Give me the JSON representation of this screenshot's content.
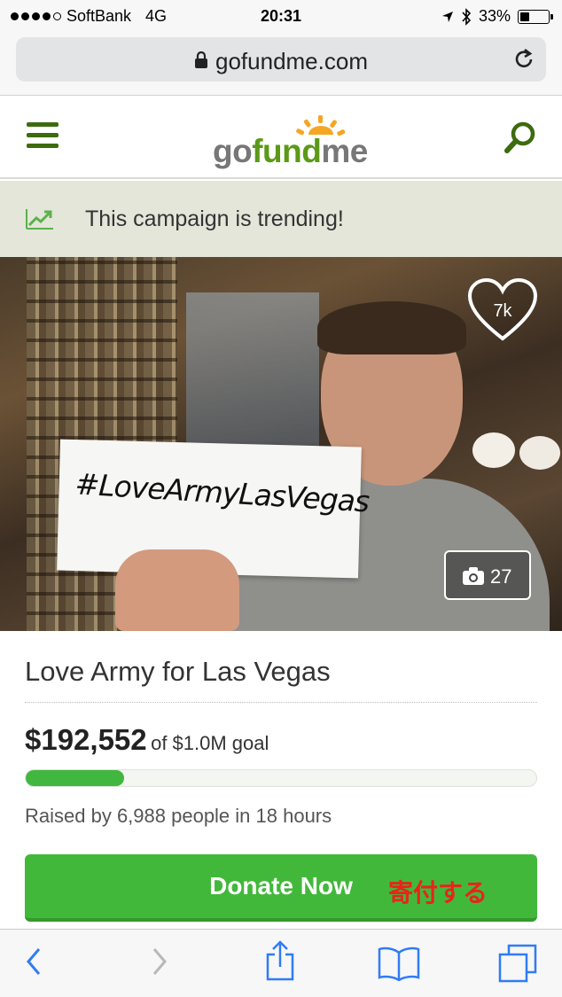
{
  "status_bar": {
    "carrier": "SoftBank",
    "network": "4G",
    "time": "20:31",
    "battery": "33%",
    "battery_level": 0.33
  },
  "browser": {
    "url": "gofundme.com"
  },
  "header": {
    "logo": "gofundme"
  },
  "banner": {
    "text": "This campaign is trending!"
  },
  "hero": {
    "sign_text": "#LoveArmyLasVegas",
    "likes": "7k",
    "photo_count": "27"
  },
  "campaign": {
    "title": "Love Army for Las Vegas",
    "amount": "$192,552",
    "goal_text": "of $1.0M goal",
    "progress_fraction": 0.1926,
    "raised_by": "Raised by 6,988 people in 18 hours"
  },
  "donate": {
    "label": "Donate Now",
    "jp_label": "寄付する"
  },
  "colors": {
    "brand_green": "#5a9a17",
    "button_green": "#42b83a",
    "icon_green": "#3d6b0f",
    "ios_blue": "#2f7cf6",
    "annotation_red": "#e8241b"
  }
}
